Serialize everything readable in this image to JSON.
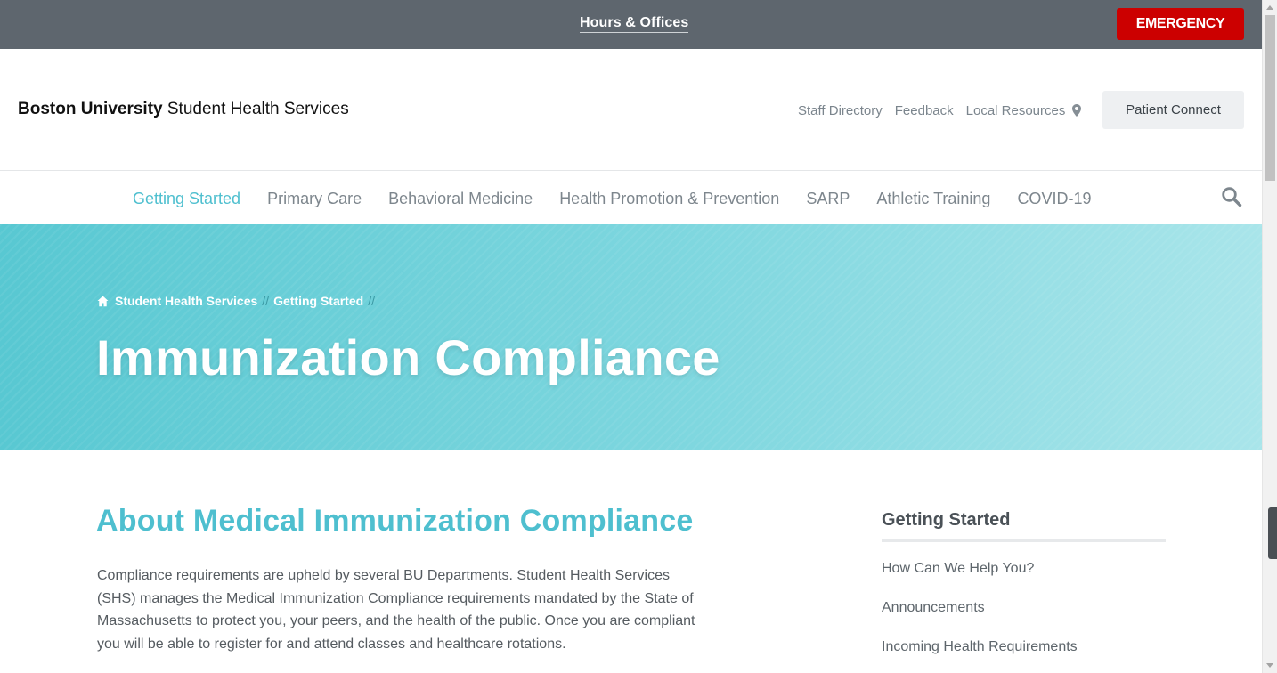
{
  "topbar": {
    "hours_link": "Hours & Offices",
    "emergency_label": "EMERGENCY",
    "emergency_color": "#cc0000"
  },
  "header": {
    "brand_bold": "Boston University",
    "brand_rest": "Student Health Services",
    "links": [
      "Staff Directory",
      "Feedback",
      "Local Resources"
    ],
    "location_icon": "map-pin-icon",
    "patient_button": "Patient Connect"
  },
  "nav": {
    "items": [
      "Getting Started",
      "Primary Care",
      "Behavioral Medicine",
      "Health Promotion & Prevention",
      "SARP",
      "Athletic Training",
      "COVID-19"
    ],
    "active": "Getting Started",
    "search_icon": "search-icon"
  },
  "hero": {
    "breadcrumb": [
      "Student Health Services",
      "Getting Started"
    ],
    "separator": "//",
    "title": "Immunization Compliance"
  },
  "main": {
    "heading": "About Medical Immunization Compliance",
    "body": "Compliance requirements are upheld by several BU Departments. Student Health Services (SHS) manages the Medical Immunization Compliance requirements mandated by the State of Massachusetts to protect you, your peers, and the health of the public. Once you are compliant you will be able to register for and attend classes and healthcare rotations."
  },
  "sidebar": {
    "title": "Getting Started",
    "items": [
      "How Can We Help You?",
      "Announcements",
      "Incoming Health Requirements"
    ]
  },
  "colors": {
    "accent": "#4ebfcf",
    "topbar": "#5e666e",
    "hero_start": "#58c8d2",
    "hero_end": "#a9e5ea"
  }
}
